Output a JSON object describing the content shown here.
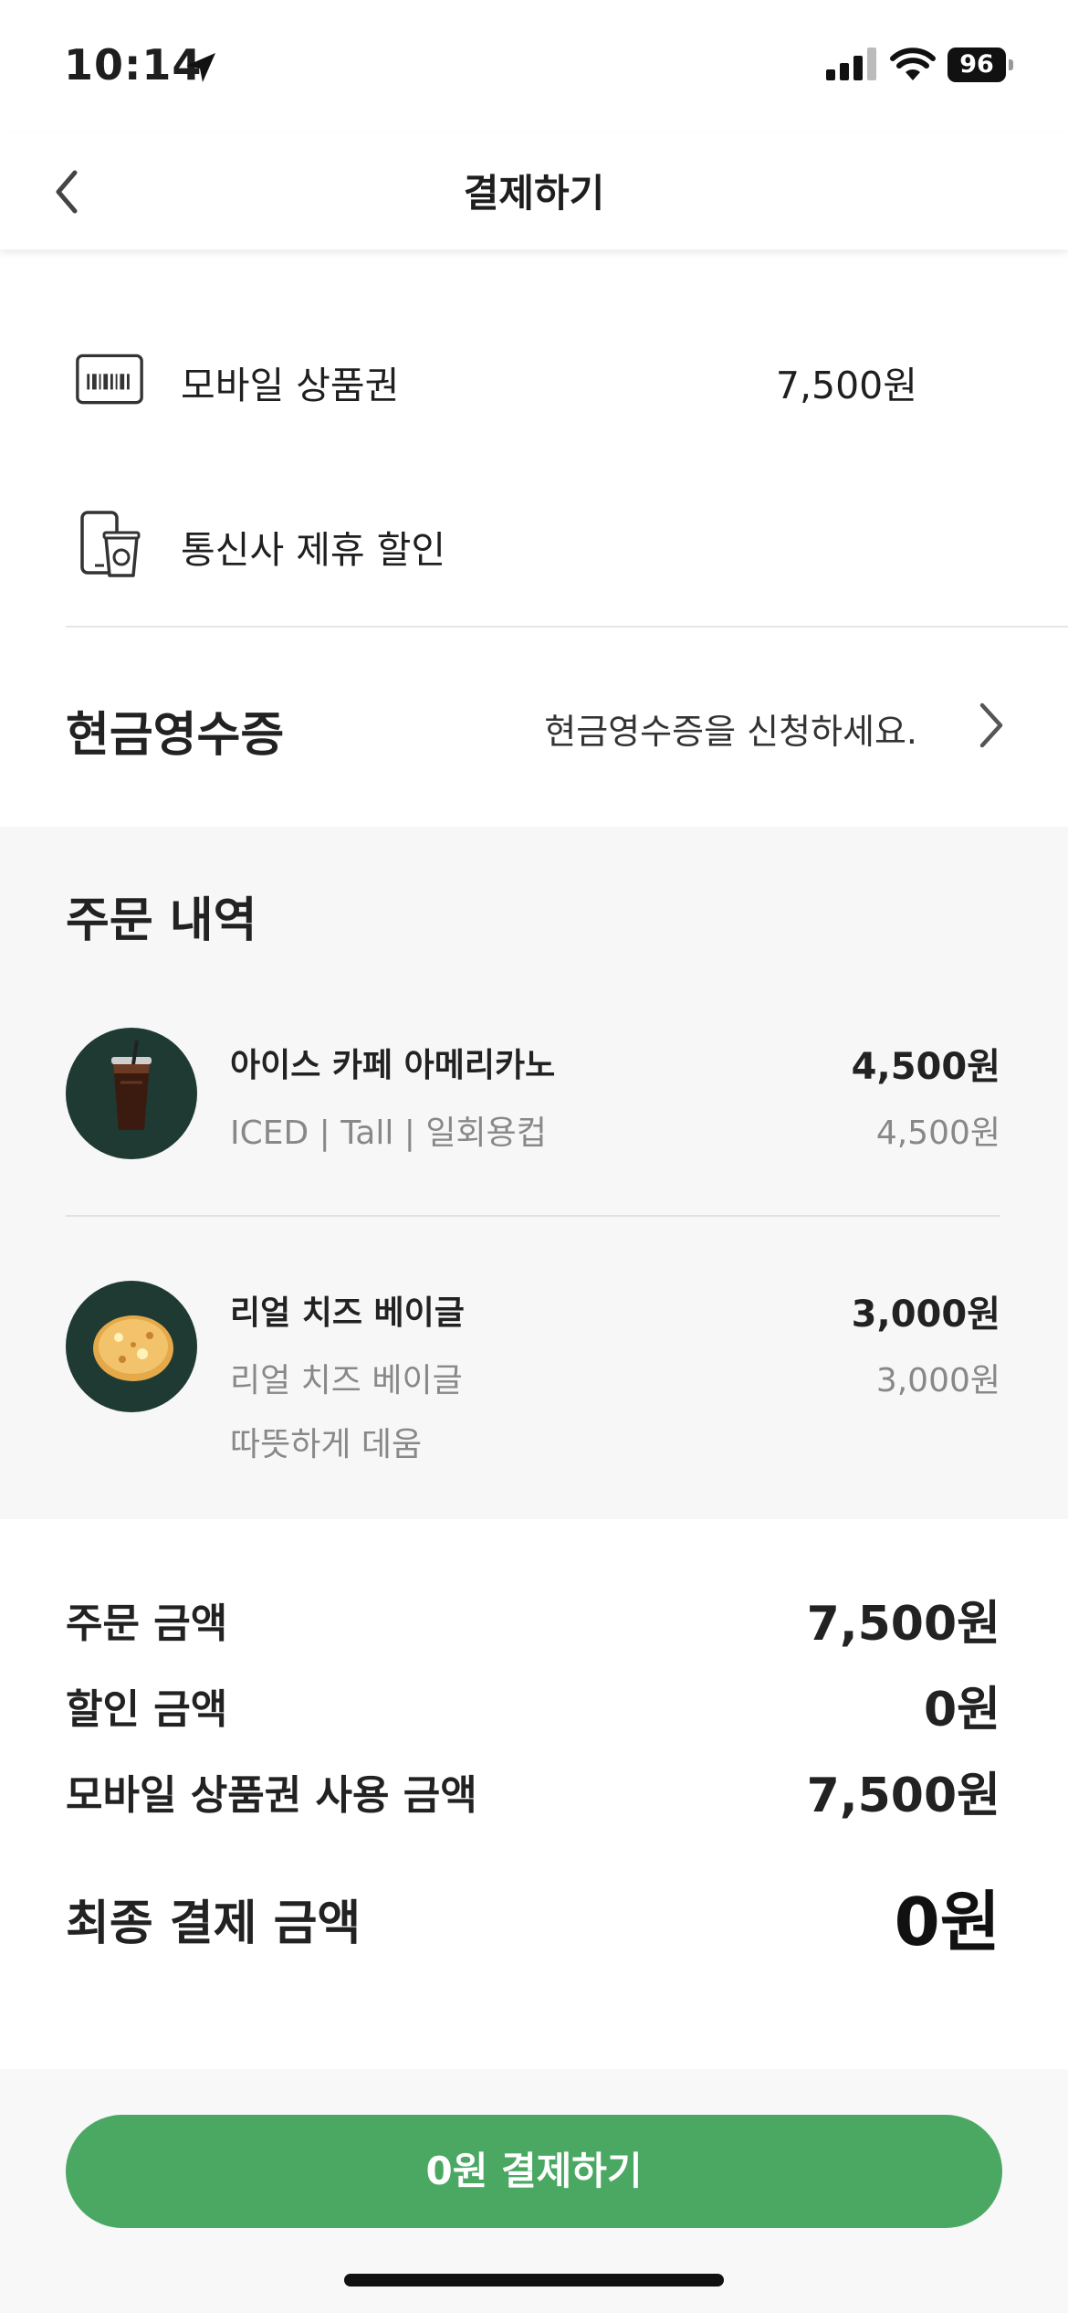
{
  "status_bar": {
    "time": "10:14",
    "battery": "96"
  },
  "header": {
    "title": "결제하기"
  },
  "payment_methods": [
    {
      "label": "모바일 상품권",
      "value": "7,500원",
      "icon": "barcode-card-icon"
    },
    {
      "label": "통신사 제휴 할인",
      "value": "",
      "icon": "phone-cup-icon"
    }
  ],
  "cash_receipt": {
    "label": "현금영수증",
    "hint": "현금영수증을 신청하세요."
  },
  "order": {
    "title": "주문 내역",
    "items": [
      {
        "name": "아이스 카페 아메리카노",
        "options": "ICED | Tall | 일회용컵",
        "price": "4,500원",
        "unit_price": "4,500원",
        "extra": ""
      },
      {
        "name": "리얼 치즈 베이글",
        "options": "리얼 치즈 베이글",
        "price": "3,000원",
        "unit_price": "3,000원",
        "extra": "따뜻하게 데움"
      }
    ]
  },
  "summary": {
    "order_amount_label": "주문 금액",
    "order_amount": "7,500원",
    "discount_label": "할인 금액",
    "discount": "0원",
    "gift_label": "모바일 상품권 사용 금액",
    "gift": "7,500원",
    "final_label": "최종 결제 금액",
    "final": "0원"
  },
  "pay_button": {
    "label": "0원 결제하기"
  },
  "colors": {
    "accent": "#4aa863",
    "dark_green": "#1e3a33",
    "gray_bg": "#f7f7f7"
  }
}
